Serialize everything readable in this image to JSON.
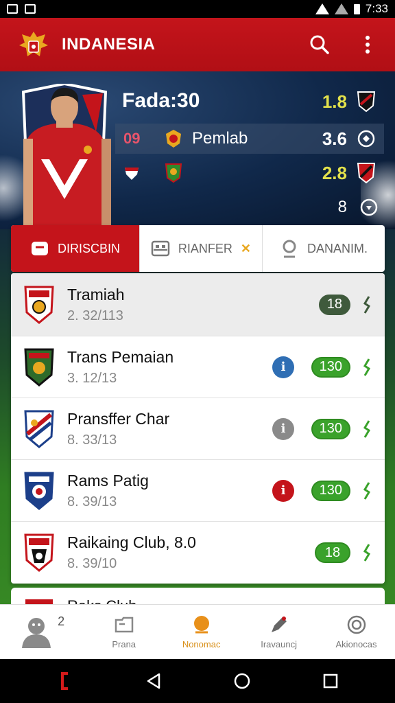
{
  "status_bar": {
    "time": "7:33"
  },
  "app_bar": {
    "title": "INDANESIA"
  },
  "hero": {
    "score_title": "Fada:30",
    "rows": [
      {
        "left": "",
        "label": "",
        "value": "1.8",
        "value_color": "yellow"
      },
      {
        "left": "09",
        "label": "Pemlab",
        "value": "3.6",
        "value_color": "white"
      },
      {
        "left": "",
        "label": "",
        "value": "2.8",
        "value_color": "yellow"
      }
    ],
    "extra": "8"
  },
  "tabs": [
    {
      "label": "DIRISCBIN",
      "active": true
    },
    {
      "label": "RIANFER",
      "active": false
    },
    {
      "label": "DANANIM.",
      "active": false
    }
  ],
  "list": [
    {
      "name": "Tramiah",
      "date": "2. 32/113",
      "badge": "18",
      "info": ""
    },
    {
      "name": "Trans Pemaian",
      "date": "3. 12/13",
      "badge": "130",
      "info": "blue"
    },
    {
      "name": "Pransffer Char",
      "date": "8. 33/13",
      "badge": "130",
      "info": "gray"
    },
    {
      "name": "Rams Patig",
      "date": "8. 39/13",
      "badge": "130",
      "info": "red"
    },
    {
      "name": "Raikaing Club, 8.0",
      "date": "8. 39/10",
      "badge": "18",
      "info": ""
    }
  ],
  "partial_item": {
    "name": "Raks Club"
  },
  "bottom_nav": [
    {
      "label": "",
      "count": "2"
    },
    {
      "label": "Prana"
    },
    {
      "label": "Nonomac",
      "active": true
    },
    {
      "label": "Iravauncj"
    },
    {
      "label": "Akionocas"
    }
  ],
  "colors": {
    "brand_red": "#c4141b",
    "badge_green": "#3aa22b",
    "active_nav": "#d9901a"
  }
}
